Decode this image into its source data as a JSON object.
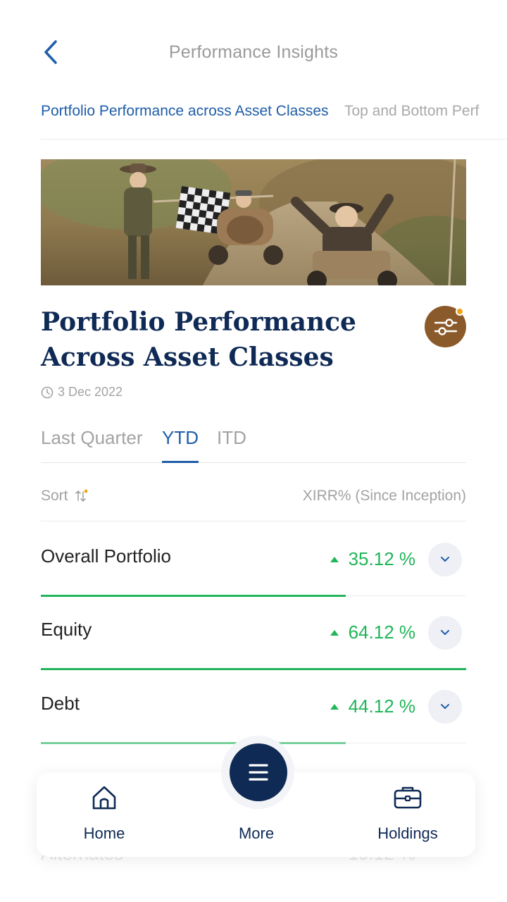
{
  "header": {
    "title": "Performance Insights",
    "back_icon": "chevron-left-icon"
  },
  "top_tabs": [
    {
      "label": "Portfolio Performance across Asset Classes",
      "active": true
    },
    {
      "label": "Top and Bottom Perf",
      "active": false
    }
  ],
  "hero": {
    "description_icon": "photo"
  },
  "section": {
    "title": "Portfolio Performance Across Asset Classes",
    "date": "3 Dec 2022",
    "filter_icon": "sliders-icon"
  },
  "period_tabs": [
    {
      "label": "Last Quarter",
      "active": false
    },
    {
      "label": "YTD",
      "active": true
    },
    {
      "label": "ITD",
      "active": false
    }
  ],
  "sort": {
    "label": "Sort",
    "metric_label": "XIRR% (Since Inception)"
  },
  "assets": [
    {
      "name": "Overall Portfolio",
      "value": "35.12 %",
      "bar_fraction": 0.7162
    },
    {
      "name": "Equity",
      "value": "64.12 %",
      "bar_fraction": 1.0
    },
    {
      "name": "Debt",
      "value": "44.12 %",
      "bar_fraction": 0.7162
    },
    {
      "name": "Alternates",
      "value": "19.12 %"
    }
  ],
  "colors": {
    "accent_blue": "#1f5ea8",
    "navy": "#0f2a55",
    "positive_green": "#22b55a",
    "filter_brown": "#8b5a2b",
    "notification_orange": "#f0a21c"
  },
  "bottom_nav": {
    "home": "Home",
    "more": "More",
    "holdings": "Holdings"
  }
}
